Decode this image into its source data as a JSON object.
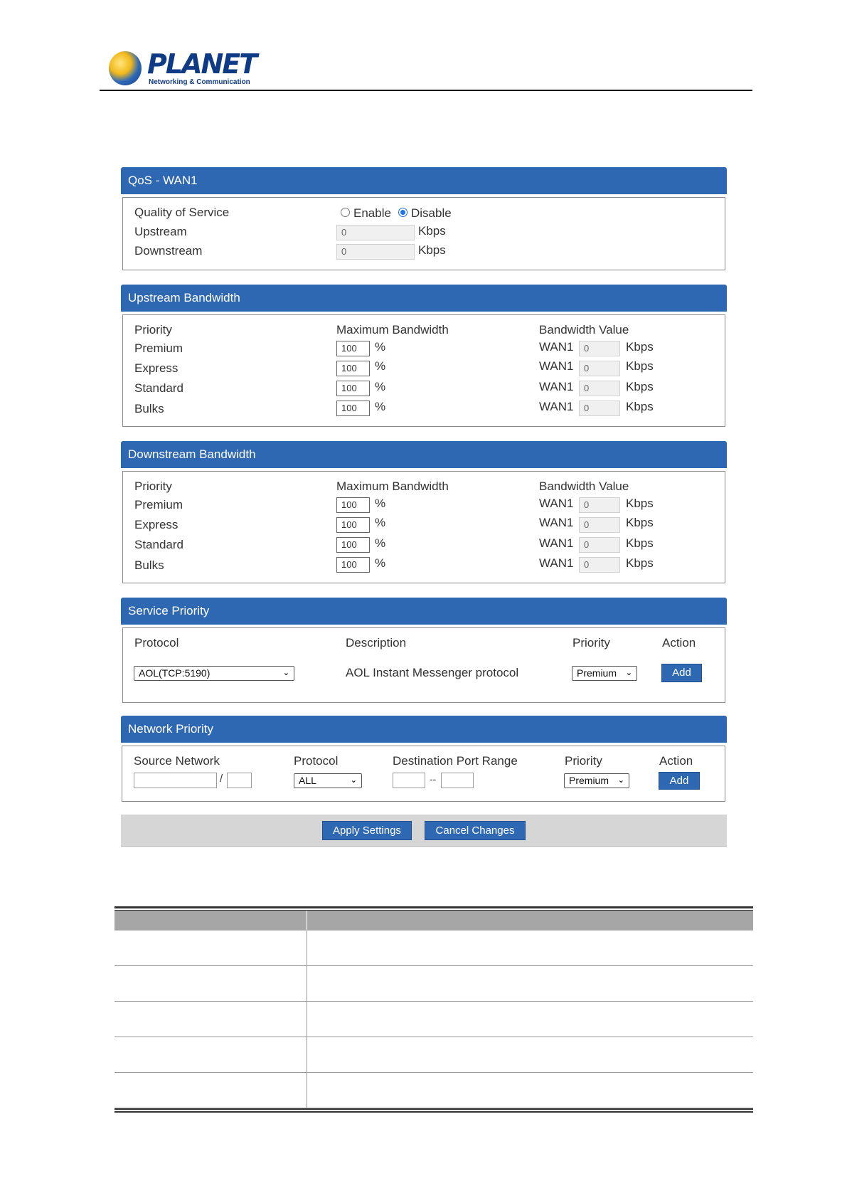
{
  "brand": {
    "name": "PLANET",
    "tagline": "Networking & Communication"
  },
  "qos": {
    "title": "QoS - WAN1",
    "rows": [
      {
        "label": "Quality of Service"
      },
      {
        "label": "Upstream",
        "value": "0",
        "unit": "Kbps"
      },
      {
        "label": "Downstream",
        "value": "0",
        "unit": "Kbps"
      }
    ],
    "enable_label": "Enable",
    "disable_label": "Disable",
    "selected": "Disable"
  },
  "upstream": {
    "title": "Upstream Bandwidth",
    "headers": [
      "Priority",
      "Maximum Bandwidth",
      "Bandwidth Value"
    ],
    "rows": [
      {
        "priority": "Premium",
        "max": "100",
        "pct": "%",
        "wan": "WAN1",
        "value": "0",
        "unit": "Kbps"
      },
      {
        "priority": "Express",
        "max": "100",
        "pct": "%",
        "wan": "WAN1",
        "value": "0",
        "unit": "Kbps"
      },
      {
        "priority": "Standard",
        "max": "100",
        "pct": "%",
        "wan": "WAN1",
        "value": "0",
        "unit": "Kbps"
      },
      {
        "priority": "Bulks",
        "max": "100",
        "pct": "%",
        "wan": "WAN1",
        "value": "0",
        "unit": "Kbps"
      }
    ]
  },
  "downstream": {
    "title": "Downstream Bandwidth",
    "headers": [
      "Priority",
      "Maximum Bandwidth",
      "Bandwidth Value"
    ],
    "rows": [
      {
        "priority": "Premium",
        "max": "100",
        "pct": "%",
        "wan": "WAN1",
        "value": "0",
        "unit": "Kbps"
      },
      {
        "priority": "Express",
        "max": "100",
        "pct": "%",
        "wan": "WAN1",
        "value": "0",
        "unit": "Kbps"
      },
      {
        "priority": "Standard",
        "max": "100",
        "pct": "%",
        "wan": "WAN1",
        "value": "0",
        "unit": "Kbps"
      },
      {
        "priority": "Bulks",
        "max": "100",
        "pct": "%",
        "wan": "WAN1",
        "value": "0",
        "unit": "Kbps"
      }
    ]
  },
  "service": {
    "title": "Service Priority",
    "headers": [
      "Protocol",
      "Description",
      "Priority",
      "Action"
    ],
    "protocol": "AOL(TCP:5190)",
    "description": "AOL Instant Messenger protocol",
    "priority": "Premium",
    "add_label": "Add"
  },
  "network": {
    "title": "Network Priority",
    "headers": [
      "Source Network",
      "Protocol",
      "Destination Port Range",
      "Priority",
      "Action"
    ],
    "slash": "/",
    "protocol": "ALL",
    "range_sep": "--",
    "priority": "Premium",
    "add_label": "Add"
  },
  "actions": {
    "apply": "Apply Settings",
    "cancel": "Cancel Changes"
  },
  "colors": {
    "accent": "#2e67b2",
    "brand": "#0f3a86"
  }
}
